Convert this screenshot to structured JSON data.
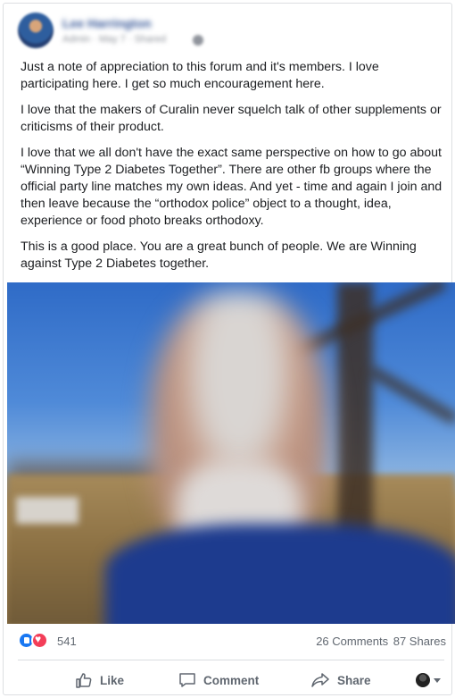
{
  "post": {
    "author_name": "Lee Harrington",
    "meta_text": "Admin · May 7 · Shared",
    "paragraphs": [
      "Just a note of appreciation to this forum and it's members.   I love participating here.  I get so much encouragement here.",
      "I love that the makers of Curalin never squelch talk of other supplements or criticisms of their product.",
      "I love that we all don't have the exact same perspective on how to go about “Winning Type 2 Diabetes Together”.   There are other fb groups where the official party line matches my own ideas.  And yet - time and again I join and then leave because the “orthodox police” object to a thought, idea, experience or food photo breaks orthodoxy.",
      "This is a good place.  You are a great bunch of people.   We are Winning against Type 2 Diabetes together."
    ]
  },
  "reactions": {
    "count": "541",
    "comments": "26 Comments",
    "shares": "87 Shares",
    "icons": [
      "like-icon",
      "love-icon"
    ],
    "colors": {
      "like": "#1877f2",
      "love": "#f33e58"
    }
  },
  "actions": {
    "like_label": "Like",
    "comment_label": "Comment",
    "share_label": "Share"
  },
  "colors": {
    "author_link": "#385898",
    "text": "#1c1e21",
    "secondary": "#606770"
  }
}
